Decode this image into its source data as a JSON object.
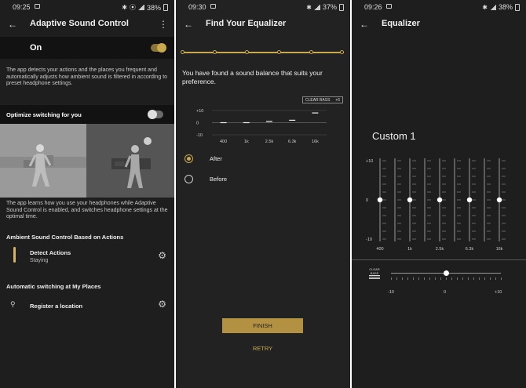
{
  "panel1": {
    "status": {
      "time": "09:25",
      "battery": "38%"
    },
    "title": "Adaptive Sound Control",
    "on_label": "On",
    "description": "The app detects your actions and the places you frequent and automatically adjusts how ambient sound is filtered in according to preset headphone settings.",
    "optimize_label": "Optimize switching for you",
    "learn_text": "The app learns how you use your headphones while Adaptive Sound Control is enabled, and switches headphone settings at the optimal time.",
    "section_actions": "Ambient Sound Control Based on Actions",
    "detect_title": "Detect Actions",
    "detect_sub": "Staying",
    "section_places": "Automatic switching at My Places",
    "register_title": "Register a location"
  },
  "panel2": {
    "status": {
      "time": "09:30",
      "battery": "37%"
    },
    "title": "Find Your Equalizer",
    "found_text": "You have found a sound balance that suits your preference.",
    "clear_bass_label": "CLEAR BASS",
    "clear_bass_value": "+6",
    "mini_eq": {
      "y_labels": [
        "+10",
        "0",
        "-10"
      ],
      "x_labels": [
        "400",
        "1k",
        "2.5k",
        "6.3k",
        "16k"
      ],
      "levels": [
        0,
        0,
        1,
        2,
        8
      ]
    },
    "option_after": "After",
    "option_before": "Before",
    "finish": "FINISH",
    "retry": "RETRY"
  },
  "panel3": {
    "status": {
      "time": "09:26",
      "battery": "38%"
    },
    "title": "Equalizer",
    "preset": "Custom 1",
    "eq": {
      "y_labels": [
        "+10",
        "0",
        "-10"
      ],
      "x_labels": [
        "400",
        "1k",
        "2.5k",
        "6.3k",
        "16k"
      ],
      "levels": [
        0,
        0,
        0,
        0,
        0
      ]
    },
    "clear_bass_label": "CLEAR BASS",
    "clear_bass_min": "-10",
    "clear_bass_mid": "0",
    "clear_bass_max": "+10",
    "clear_bass_value": 0
  },
  "colors": {
    "accent": "#c9a94e",
    "background": "#1e1e1e",
    "row_dark": "#121212"
  }
}
